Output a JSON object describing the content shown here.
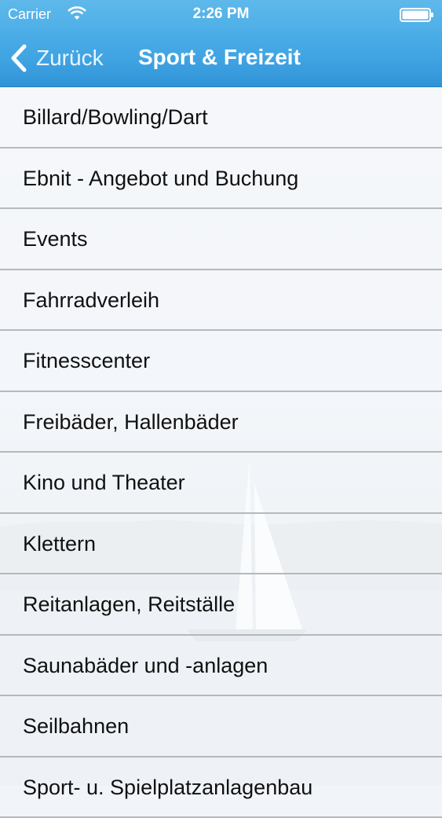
{
  "status_bar": {
    "carrier": "Carrier",
    "time": "2:26 PM",
    "wifi_icon": "wifi-icon",
    "battery_icon": "battery-icon"
  },
  "nav": {
    "back_label": "Zurück",
    "back_icon": "chevron-left-icon",
    "title": "Sport & Freizeit"
  },
  "list": {
    "items": [
      {
        "label": "Billard/Bowling/Dart"
      },
      {
        "label": "Ebnit - Angebot und Buchung"
      },
      {
        "label": "Events"
      },
      {
        "label": "Fahrradverleih"
      },
      {
        "label": "Fitnesscenter"
      },
      {
        "label": "Freibäder, Hallenbäder"
      },
      {
        "label": "Kino und Theater"
      },
      {
        "label": "Klettern"
      },
      {
        "label": "Reitanlagen, Reitställe"
      },
      {
        "label": "Saunabäder und -anlagen"
      },
      {
        "label": "Seilbahnen"
      },
      {
        "label": "Sport- u. Spielplatzanlagenbau"
      }
    ]
  },
  "colors": {
    "nav_bar": "#3fa3e2",
    "status_bar": "#5fb8ea",
    "separator": "#b4b9be",
    "item_text": "#111111"
  }
}
